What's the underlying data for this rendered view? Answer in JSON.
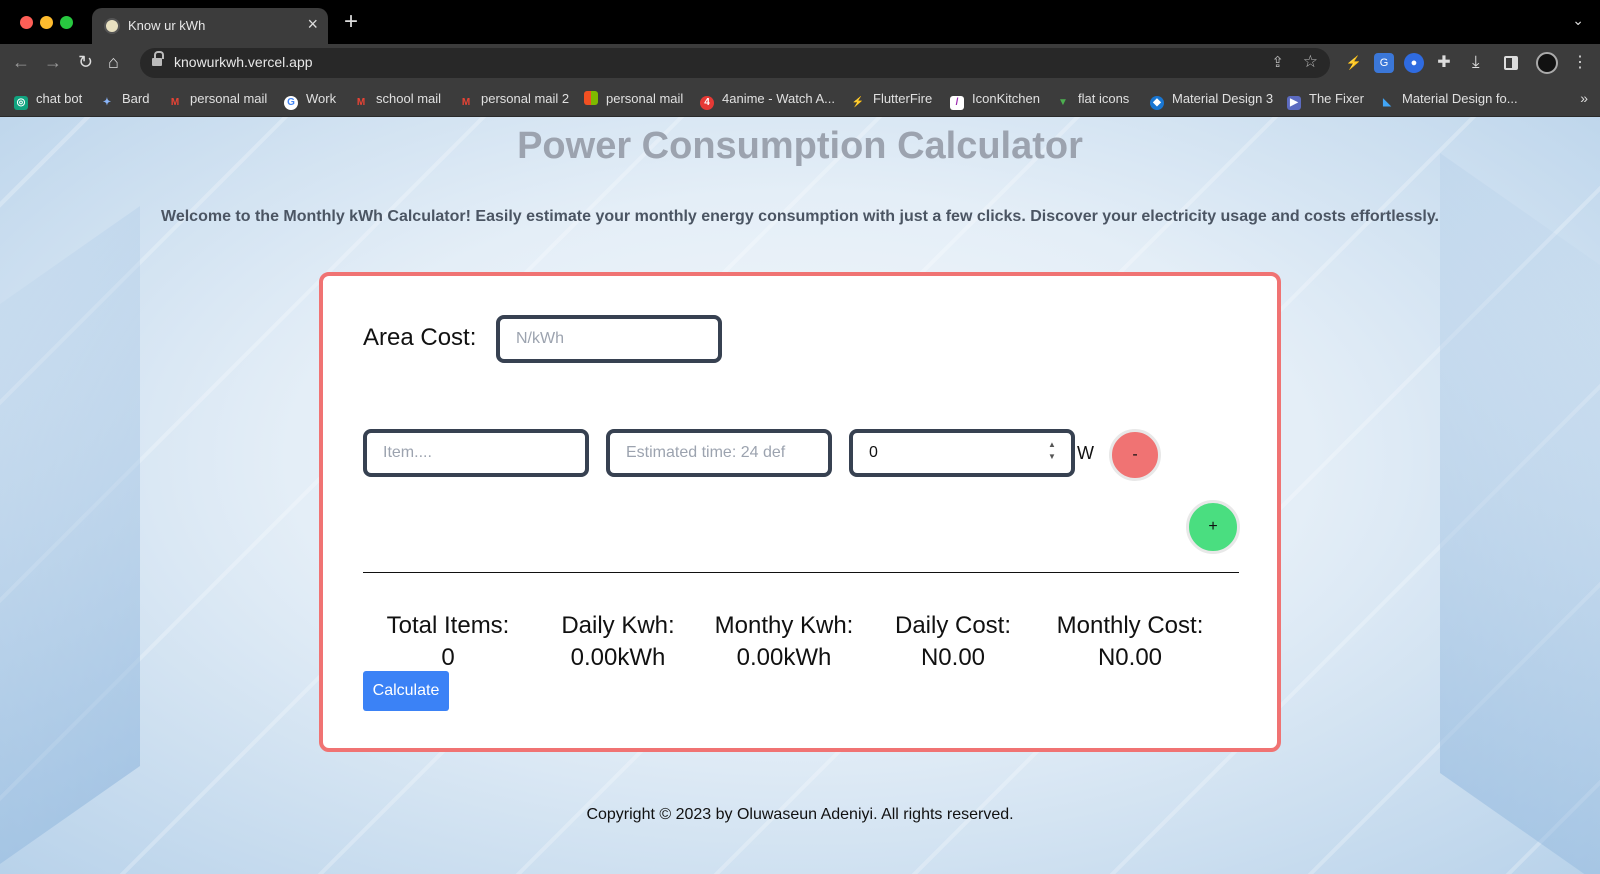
{
  "browser": {
    "tab_title": "Know ur kWh",
    "url": "knowurkwh.vercel.app",
    "bookmarks": [
      {
        "label": "chat bot",
        "icon": "chatgpt-icon",
        "color": "#10a37f"
      },
      {
        "label": "Bard",
        "icon": "sparkle-icon",
        "color": "#8ab4f8"
      },
      {
        "label": "personal mail",
        "icon": "gmail-icon",
        "color": "#ea4335"
      },
      {
        "label": "Work",
        "icon": "google-icon",
        "color": "#4285f4"
      },
      {
        "label": "school mail",
        "icon": "gmail-icon",
        "color": "#ea4335"
      },
      {
        "label": "personal mail 2",
        "icon": "gmail-icon",
        "color": "#ea4335"
      },
      {
        "label": "personal mail",
        "icon": "microsoft-icon",
        "color": "#f25022"
      },
      {
        "label": "4anime - Watch A...",
        "icon": "4anime-icon",
        "color": "#e53935"
      },
      {
        "label": "FlutterFire",
        "icon": "flutterfire-icon",
        "color": "#ffca28"
      },
      {
        "label": "IconKitchen",
        "icon": "iconkitchen-icon",
        "color": "#9c27b0"
      },
      {
        "label": "flat icons",
        "icon": "flaticon-icon",
        "color": "#4caf50"
      },
      {
        "label": "Material Design 3",
        "icon": "material-icon",
        "color": "#1976d2"
      },
      {
        "label": "The Fixer",
        "icon": "play-icon",
        "color": "#5c6bc0"
      },
      {
        "label": "Material Design fo...",
        "icon": "flutter-icon",
        "color": "#42a5f5"
      }
    ]
  },
  "page": {
    "title": "Power Consumption Calculator",
    "subtitle": "Welcome to the Monthly kWh Calculator! Easily estimate your monthly energy consumption with just a few clicks. Discover your electricity usage and costs effortlessly.",
    "area_cost_label": "Area Cost:",
    "area_cost_placeholder": "N/kWh",
    "item_placeholder": "Item....",
    "time_placeholder": "Estimated time: 24 def",
    "watt_value": "0",
    "watt_unit": "W",
    "remove_label": "-",
    "add_label": "+",
    "stats": [
      {
        "label": "Total Items:",
        "value": "0"
      },
      {
        "label": "Daily Kwh:",
        "value": "0.00kWh"
      },
      {
        "label": "Monthy Kwh:",
        "value": "0.00kWh"
      },
      {
        "label": "Daily Cost:",
        "value": "N0.00"
      },
      {
        "label": "Monthly Cost:",
        "value": "N0.00"
      }
    ],
    "calculate_label": "Calculate",
    "footer": "Copyright © 2023 by Oluwaseun Adeniyi. All rights reserved."
  },
  "colors": {
    "card_border": "#f07373",
    "remove_button": "#f07373",
    "add_button": "#4ade80",
    "calculate_button": "#3b82f6",
    "title": "#9ca3af"
  }
}
